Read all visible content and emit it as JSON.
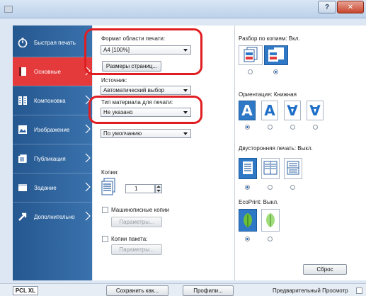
{
  "titlebar": {
    "help": "?",
    "close": "✕"
  },
  "sidebar": {
    "items": [
      {
        "label": "Быстрая печать",
        "icon": "quick-print-icon"
      },
      {
        "label": "Основные",
        "icon": "basic-icon",
        "active": true
      },
      {
        "label": "Компоновка",
        "icon": "layout-icon"
      },
      {
        "label": "Изображение",
        "icon": "image-icon"
      },
      {
        "label": "Публикация",
        "icon": "publishing-icon"
      },
      {
        "label": "Задание",
        "icon": "job-icon"
      },
      {
        "label": "Дополнительно",
        "icon": "advanced-icon"
      }
    ]
  },
  "main": {
    "print_size_label": "Формат области печати:",
    "print_size_value": "A4  [100%]",
    "page_sizes_button": "Размеры страниц...",
    "source_label": "Источник:",
    "source_value": "Автоматический выбор",
    "media_type_label": "Тип материала для печати:",
    "media_type_value": "Не указано",
    "default_select_value": "По умолчанию",
    "copies_label": "Копии:",
    "copies_value": "1",
    "mopy_label": "Машинописные копии",
    "mopy_params_button": "Параметры...",
    "pack_copies_label": "Копии пакета:",
    "pack_params_button": "Параметры...",
    "collate_label": "Разбор по копиям:  Вкл.",
    "orientation_label": "Ориентация:  Книжная",
    "orientation_glyphs": [
      "A",
      "A",
      "∀",
      "∀"
    ],
    "duplex_label": "Двусторонняя печать:  Выкл.",
    "ecoprint_label": "EcoPrint:  Выкл.",
    "reset_button": "Сброс"
  },
  "statusbar": {
    "pcl": "PCL XL",
    "save_as": "Сохранить как...",
    "profiles": "Профили...",
    "preview": "Предварительный Просмотр"
  },
  "colors": {
    "accent_red": "#e43a3c",
    "sidebar_blue": "#2b62a0",
    "selected_blue": "#2e78c6",
    "highlight_ring": "#e01e22"
  }
}
